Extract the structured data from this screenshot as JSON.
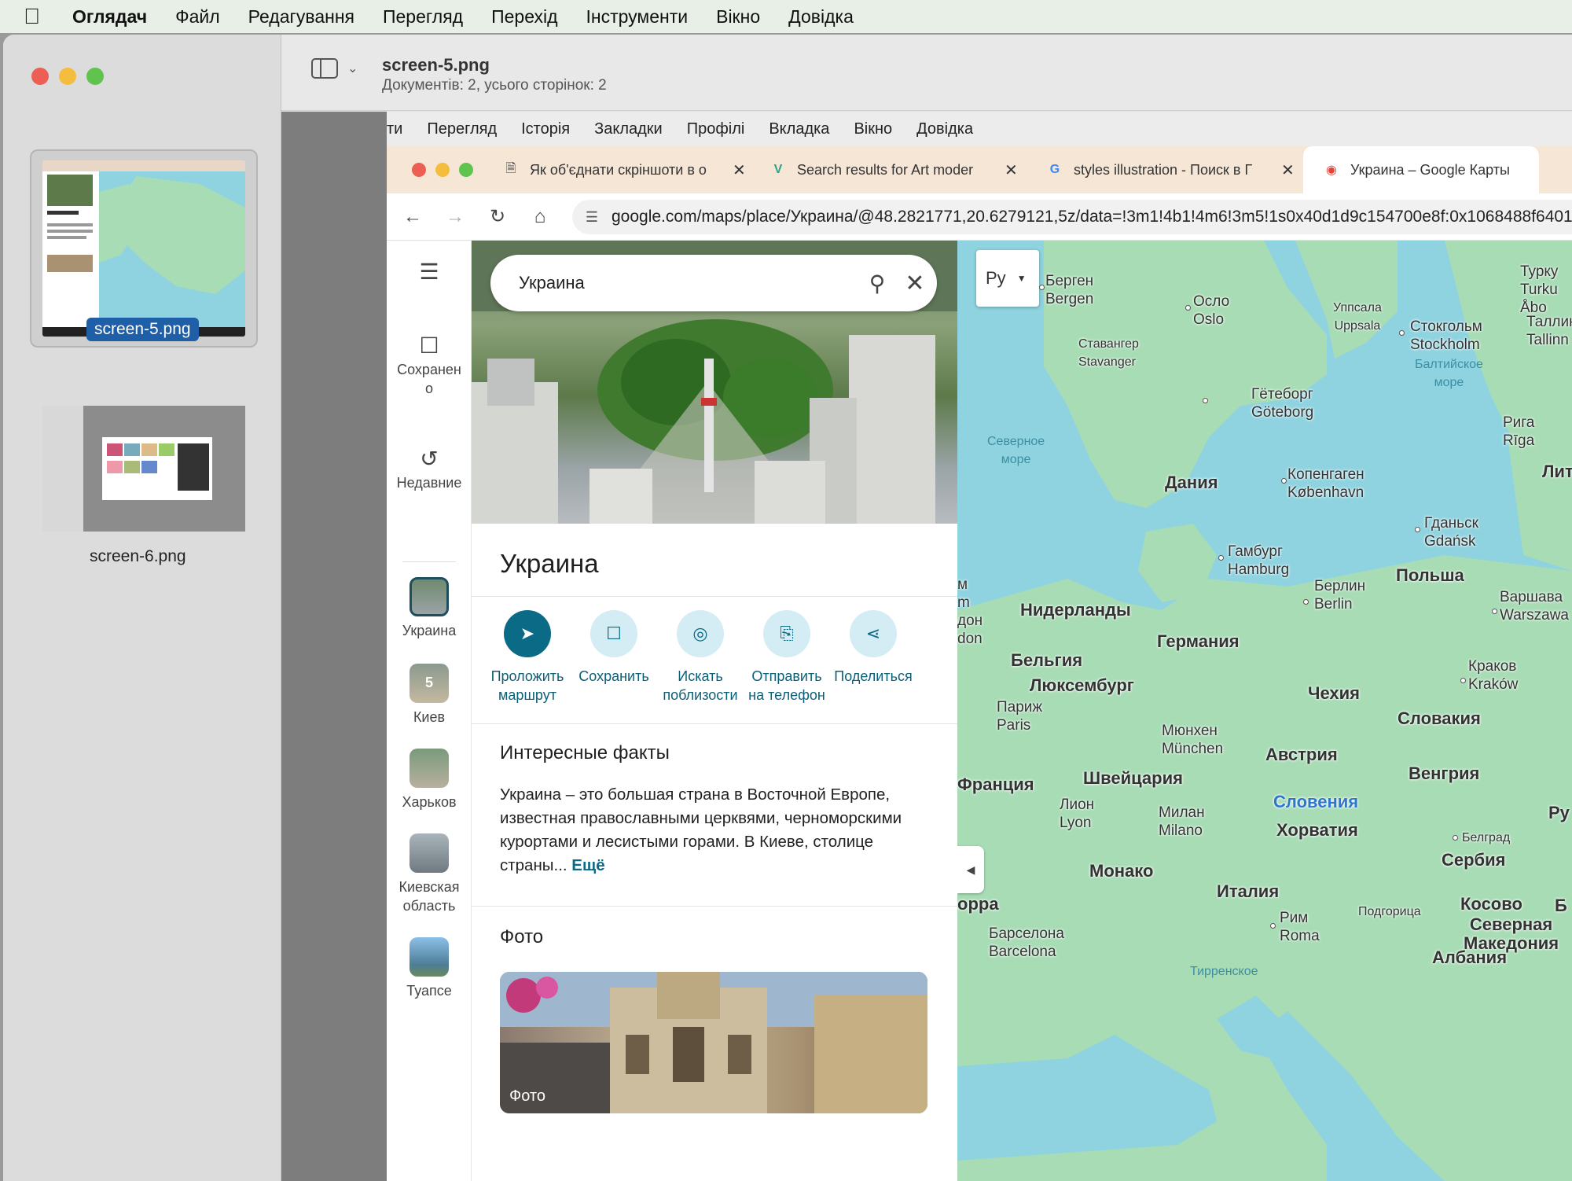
{
  "menubar": {
    "app": "Оглядач",
    "items": [
      "Файл",
      "Редагування",
      "Перегляд",
      "Перехід",
      "Інструменти",
      "Вікно",
      "Довідка"
    ]
  },
  "window": {
    "title": "screen-5.png",
    "subtitle": "Документів: 2, усього сторінок: 2"
  },
  "thumbnails": [
    {
      "label": "screen-5.png",
      "selected": true
    },
    {
      "label": "screen-6.png",
      "selected": false
    }
  ],
  "chrome": {
    "menu": [
      "ти",
      "Перегляд",
      "Історія",
      "Закладки",
      "Профілі",
      "Вкладка",
      "Вікно",
      "Довідка"
    ],
    "tabs": [
      {
        "label": "Як об'єднати скріншоти в о",
        "icon": "document-icon"
      },
      {
        "label": "Search results for Art moder",
        "icon": "vector-logo-icon"
      },
      {
        "label": "styles illustration - Поиск в Г",
        "icon": "google-icon"
      },
      {
        "label": "Украина – Google Карты",
        "icon": "maps-pin-icon"
      }
    ],
    "url": "google.com/maps/place/Украина/@48.2821771,20.6279121,5z/data=!3m1!4b1!4m6!3m5!1s0x40d1d9c154700e8f:0x1068488f64010"
  },
  "maps": {
    "search_value": "Украина",
    "rail": {
      "saved": "Сохранено",
      "recent": "Недавние",
      "places": [
        {
          "label": "Украина"
        },
        {
          "label": "Киев",
          "badge": "5"
        },
        {
          "label": "Харьков"
        },
        {
          "label": "Киевская область"
        },
        {
          "label": "Туапсе"
        }
      ]
    },
    "place": {
      "title": "Украина",
      "actions": [
        {
          "label": "Проложить маршрут",
          "icon": "directions-icon"
        },
        {
          "label": "Сохранить",
          "icon": "bookmark-icon"
        },
        {
          "label": "Искать поблизости",
          "icon": "nearby-icon"
        },
        {
          "label": "Отправить на телефон",
          "icon": "send-to-phone-icon"
        },
        {
          "label": "Поделиться",
          "icon": "share-icon"
        }
      ],
      "facts_heading": "Интересные факты",
      "facts_text": "Украина – это большая страна в Восточной Европе, известная православными церквями, черноморскими курортами и лесистыми горами. В Киеве, столице страны...",
      "facts_more": "Ещё",
      "photos_heading": "Фото",
      "photo_label": "Фото"
    },
    "layer_button": "Ру",
    "labels": {
      "bergen": "Берген\nBergen",
      "oslo": "Осло\nOslo",
      "uppsala": "Уппсала\nUppsala",
      "stockholm": "Стокгольм\nStockholm",
      "stavanger": "Ставангер\nStavanger",
      "baltic": "Балтийское\nморе",
      "north_sea": "Северное\nморе",
      "goteborg": "Гётеборг\nGöteborg",
      "riga": "Рига\nRīga",
      "kobenhavn": "Копенгаген\nKøbenhavn",
      "denmark": "Дания",
      "gdansk": "Гданьск\nGdańsk",
      "hamburg": "Гамбург\nHamburg",
      "poland": "Польша",
      "berlin": "Берлин\nBerlin",
      "warsaw": "Варшава\nWarszawa",
      "netherlands": "Нидерланды",
      "germany": "Германия",
      "belgium": "Бельгия",
      "luxembourg": "Люксембург",
      "krakow": "Краков\nKraków",
      "czech": "Чехия",
      "paris": "Париж\nParis",
      "slovakia": "Словакия",
      "munich": "Мюнхен\nMünchen",
      "austria": "Австрия",
      "france": "Франция",
      "switzerland": "Швейцария",
      "hungary": "Венгрия",
      "lyon": "Лион\nLyon",
      "milan": "Милан\nMilano",
      "slovenia": "Словения",
      "croatia": "Хорватия",
      "belgrade": "Белград",
      "serbia": "Сербия",
      "monaco": "Монако",
      "italy": "Италия",
      "podgorica": "Подгорица",
      "kosovo": "Косово",
      "rome": "Рим\nRoma",
      "north_macedonia": "Северная\nМакедония",
      "barcelona": "Барселона\nBarcelona",
      "albania": "Албания",
      "tyrrhenian": "Тирренское",
      "turku": "Турку\nTurku\nÅbo",
      "tallinn": "Таллин\nTallinn",
      "lit": "Лит",
      "ru": "Ру",
      "b": "Б",
      "edge_london": "м\nm\nдон\ndon",
      "edge_andorra": "орра"
    },
    "colors": {
      "land": "#a8dcb5",
      "water": "#8fd3e0",
      "accent": "#0b6a85"
    }
  }
}
